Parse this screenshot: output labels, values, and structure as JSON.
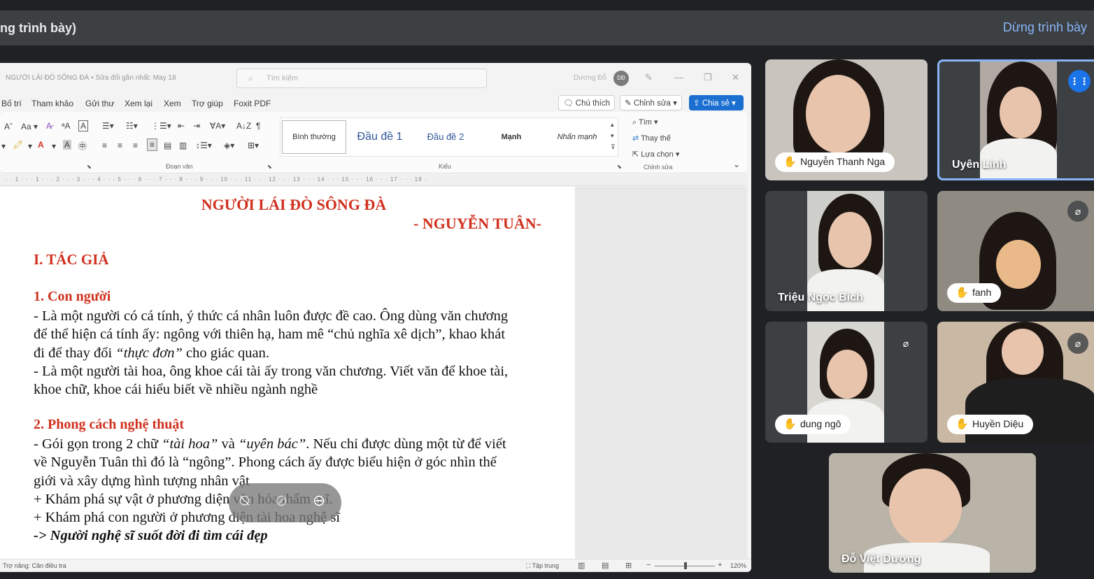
{
  "presenting": {
    "title": "ng trình bày)",
    "stop_label": "Dừng trình bày"
  },
  "word": {
    "doc_name": "NGƯỜI LÁI ĐÒ SÔNG ĐÀ • Sửa đổi gần nhất: May 18",
    "search_placeholder": "Tìm kiếm",
    "user_name": "Dương Đỗ",
    "user_initials": "DĐ",
    "menu": [
      "Bố trí",
      "Tham khảo",
      "Gửi thư",
      "Xem lại",
      "Xem",
      "Trợ giúp",
      "Foxit PDF"
    ],
    "comments_label": "Chú thích",
    "editing_label": "Chỉnh sửa",
    "share_label": "Chia sẻ",
    "styles": {
      "normal": "Bình thường",
      "h1": "Đầu đề 1",
      "h2": "Đầu đề 2",
      "strong": "Mạnh",
      "emphasis": "Nhấn mạnh"
    },
    "group_labels": {
      "paragraph": "Đoạn văn",
      "styles": "Kiểu",
      "editing": "Chỉnh sửa"
    },
    "editing": {
      "find": "Tìm",
      "replace": "Thay thế",
      "select": "Lựa chọn"
    },
    "font_size_label": "Aa",
    "ruler": "· · 1 · · · 1 · · · 2 · · · 3 · · · 4 · · · 5 · · · 6 · · · 7 · · · 8 · · · 9 · · · 10 · · · 11 · · · 12 · · · 13 · · · 14 · · · 15 · · · 16 · · · 17 · · · 18 ·",
    "status_left": "Trợ năng: Cần điều tra",
    "status_focus": "Tập trung",
    "zoom": "120%"
  },
  "document": {
    "title": "NGƯỜI LÁI ĐÒ SÔNG ĐÀ",
    "author": "- NGUYỄN TUÂN-",
    "section1": "I. TÁC GIẢ",
    "sub1": "1. Con người",
    "p1_l1": "- Là một người có cá tính, ý thức cá nhân luôn được đề cao. Ông dùng văn chương",
    "p1_l2": "để thể hiện cá tính ấy: ngông với thiên hạ, ham mê “chủ nghĩa xê dịch”, khao khát",
    "p1_l3a": "đi để thay đổi ",
    "p1_l3b": "“thực đơn”",
    "p1_l3c": " cho giác quan.",
    "p2_l1": "- Là một người tài hoa, ông khoe cái tài ấy trong văn chương. Viết văn để khoe tài,",
    "p2_l2": "khoe chữ, khoe cái hiểu biết về nhiều ngành nghề",
    "sub2": "2. Phong cách nghệ thuật",
    "p3_l1a": "- Gói gọn trong 2 chữ ",
    "p3_l1b": "“tài hoa”",
    "p3_l1c": " và ",
    "p3_l1d": "“uyên bác”",
    "p3_l1e": ". Nếu chỉ được dùng một từ để viết",
    "p3_l2": "về Nguyễn Tuân thì đó là “ngông”. Phong cách ấy được biểu hiện ở góc nhìn thế",
    "p3_l3": "giới và xây dựng hình tượng nhân vật",
    "p4": "+ Khám phá sự vật ở phương diện văn hóa thẩm mĩ.",
    "p5": "+ Khám phá con người ở phương diện tài hoa nghệ sĩ",
    "p6": "-> Người nghệ sĩ suốt đời đi tìm cái đẹp"
  },
  "participants": [
    {
      "name": "Nguyễn Thanh Nga",
      "hand_raised": true
    },
    {
      "name": "Uyên Linh",
      "speaking": true
    },
    {
      "name": "Triệu Ngọc Bích"
    },
    {
      "name": "fanh",
      "hand_raised": true,
      "muted": true
    },
    {
      "name": "dung ngô",
      "hand_raised": true,
      "muted": true
    },
    {
      "name": "Huyền Diệu",
      "hand_raised": true,
      "muted": true
    },
    {
      "name": "Đỗ Việt Dương"
    }
  ],
  "colors": {
    "meet_bg": "#202124",
    "accent_blue": "#8ab4f8",
    "doc_red": "#d0311f",
    "word_share": "#1b6fd1"
  }
}
